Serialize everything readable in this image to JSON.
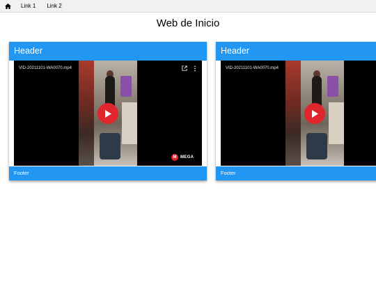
{
  "nav": {
    "home_icon": "home-icon",
    "links": [
      "Link 1",
      "Link 2"
    ]
  },
  "page_title": "Web de Inicio",
  "cards": [
    {
      "header": "Header",
      "footer": "Footer",
      "video": {
        "filename": "VID-20211101-WA0070.mp4",
        "brand": "MEGA",
        "brand_logo_letter": "M",
        "play_icon": "play-icon",
        "open_icon": "external-link-icon",
        "more_icon": "more-vertical-icon"
      }
    },
    {
      "header": "Header",
      "footer": "Footer",
      "video": {
        "filename": "VID-20211101-WA0070.mp4",
        "play_icon": "play-icon"
      }
    }
  ],
  "colors": {
    "accent": "#2196f3",
    "play": "#e0262d",
    "navbar_bg": "#f1f1f1"
  }
}
